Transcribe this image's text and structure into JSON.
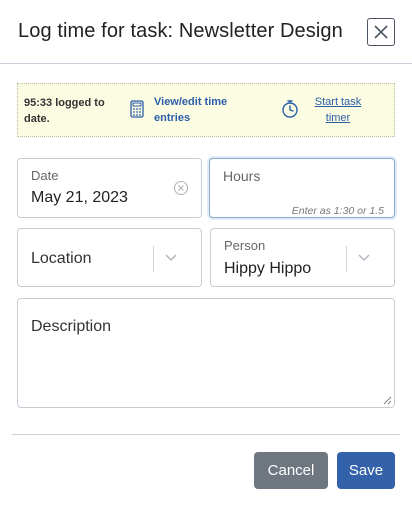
{
  "dialog": {
    "title": "Log time for task: Newsletter Design"
  },
  "info": {
    "logged_text": "95:33 logged to date.",
    "view_link": "View/edit time entries",
    "timer_link": "Start task timer"
  },
  "fields": {
    "date": {
      "label": "Date",
      "value": "May 21, 2023"
    },
    "hours": {
      "placeholder": "Hours",
      "hint": "Enter as 1:30 or 1.5"
    },
    "location": {
      "placeholder": "Location"
    },
    "person": {
      "label": "Person",
      "value": "Hippy Hippo"
    },
    "description": {
      "placeholder": "Description"
    }
  },
  "buttons": {
    "cancel": "Cancel",
    "save": "Save"
  },
  "colors": {
    "primary": "#3362aa",
    "secondary": "#6e7780",
    "link": "#2a5fa8",
    "info_bg": "#fcfce3",
    "focus_border": "#8ea9d0"
  },
  "icons": {
    "close": "close-icon",
    "calculator": "calculator-icon",
    "timer": "stopwatch-icon",
    "clear": "clear-circle-icon",
    "dropdown": "chevron-down-icon",
    "resize": "resize-grip-icon"
  }
}
